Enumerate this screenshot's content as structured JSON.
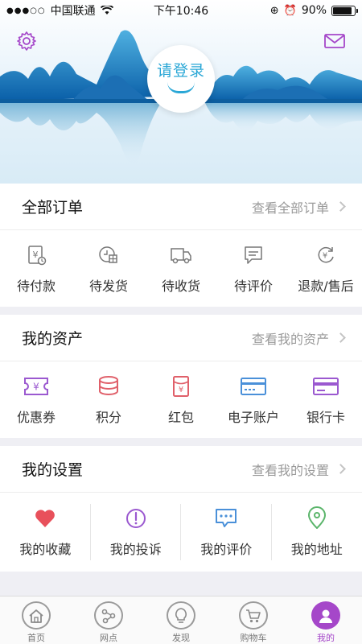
{
  "status_bar": {
    "carrier": "中国联通",
    "time": "下午10:46",
    "battery": "90%",
    "battery_level": 0.9
  },
  "header": {
    "login_label": "请登录",
    "settings_icon": "gear-icon",
    "message_icon": "mail-icon"
  },
  "orders": {
    "title": "全部订单",
    "link": "查看全部订单",
    "items": [
      {
        "label": "待付款",
        "icon": "pending-payment-icon"
      },
      {
        "label": "待发货",
        "icon": "pending-shipment-icon"
      },
      {
        "label": "待收货",
        "icon": "delivery-truck-icon"
      },
      {
        "label": "待评价",
        "icon": "review-icon"
      },
      {
        "label": "退款/售后",
        "icon": "refund-icon"
      }
    ]
  },
  "assets": {
    "title": "我的资产",
    "link": "查看我的资产",
    "items": [
      {
        "label": "优惠券",
        "icon": "coupon-icon",
        "color": "#9b59d0"
      },
      {
        "label": "积分",
        "icon": "coins-icon",
        "color": "#e0606a"
      },
      {
        "label": "红包",
        "icon": "red-envelope-icon",
        "color": "#e0606a"
      },
      {
        "label": "电子账户",
        "icon": "e-account-card-icon",
        "color": "#4a90d9"
      },
      {
        "label": "银行卡",
        "icon": "bank-card-icon",
        "color": "#9b59d0"
      }
    ]
  },
  "settings": {
    "title": "我的设置",
    "link": "查看我的设置",
    "items": [
      {
        "label": "我的收藏",
        "icon": "heart-icon",
        "color": "#e8505b"
      },
      {
        "label": "我的投诉",
        "icon": "exclamation-icon",
        "color": "#9b59d0"
      },
      {
        "label": "我的评价",
        "icon": "chat-bubble-icon",
        "color": "#4a90d9"
      },
      {
        "label": "我的地址",
        "icon": "location-pin-icon",
        "color": "#5bb56b"
      }
    ]
  },
  "tabbar": {
    "tabs": [
      {
        "label": "首页",
        "icon": "home-icon"
      },
      {
        "label": "网点",
        "icon": "network-points-icon"
      },
      {
        "label": "发现",
        "icon": "lightbulb-icon"
      },
      {
        "label": "购物车",
        "icon": "cart-icon"
      },
      {
        "label": "我的",
        "icon": "user-icon",
        "active": true
      }
    ]
  },
  "colors": {
    "accent": "#a547c9",
    "login_blue": "#2aa7d6"
  }
}
